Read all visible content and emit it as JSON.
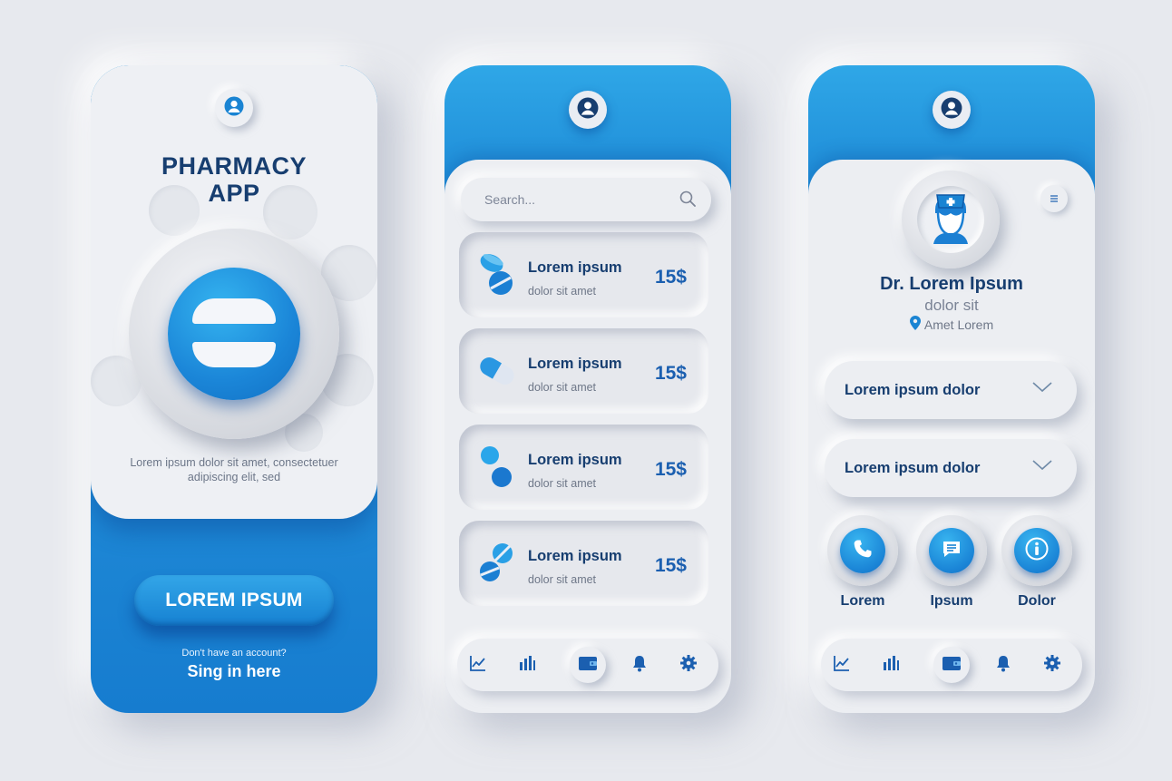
{
  "colors": {
    "accent": "#1a84d3",
    "navy": "#173e70",
    "background": "#e7e9ee"
  },
  "screen1": {
    "avatar_icon": "user-icon",
    "title": "PHARMACY\nAPP",
    "description": "Lorem ipsum dolor sit amet, consectetuer adipiscing elit, sed",
    "cta_label": "LOREM IPSUM",
    "signup_question": "Don't have an account?",
    "signup_link": "Sing in here"
  },
  "screen2": {
    "avatar_icon": "user-icon",
    "search_placeholder": "Search...",
    "search_icon": "search-icon",
    "products": [
      {
        "name": "Lorem ipsum",
        "desc": "dolor sit amet",
        "price": "15$",
        "icon": "pill-pair-icon"
      },
      {
        "name": "Lorem ipsum",
        "desc": "dolor sit amet",
        "price": "15$",
        "icon": "capsule-icon"
      },
      {
        "name": "Lorem ipsum",
        "desc": "dolor sit amet",
        "price": "15$",
        "icon": "round-pills-icon"
      },
      {
        "name": "Lorem ipsum",
        "desc": "dolor sit amet",
        "price": "15$",
        "icon": "tablets-icon"
      }
    ],
    "nav": [
      "line-chart-icon",
      "bar-chart-icon",
      "wallet-icon",
      "bell-icon",
      "gear-icon"
    ],
    "nav_active": "wallet-icon"
  },
  "screen3": {
    "avatar_icon": "user-icon",
    "doctor_icon": "nurse-icon",
    "menu_icon": "menu-icon",
    "name": "Dr. Lorem Ipsum",
    "subtitle": "dolor sit",
    "location": "Amet Lorem",
    "dropdowns": [
      "Lorem ipsum dolor",
      "Lorem ipsum dolor"
    ],
    "actions": [
      {
        "label": "Lorem",
        "icon": "phone-icon"
      },
      {
        "label": "Ipsum",
        "icon": "chat-icon"
      },
      {
        "label": "Dolor",
        "icon": "info-icon"
      }
    ],
    "nav": [
      "line-chart-icon",
      "bar-chart-icon",
      "wallet-icon",
      "bell-icon",
      "gear-icon"
    ],
    "nav_active": "wallet-icon"
  }
}
